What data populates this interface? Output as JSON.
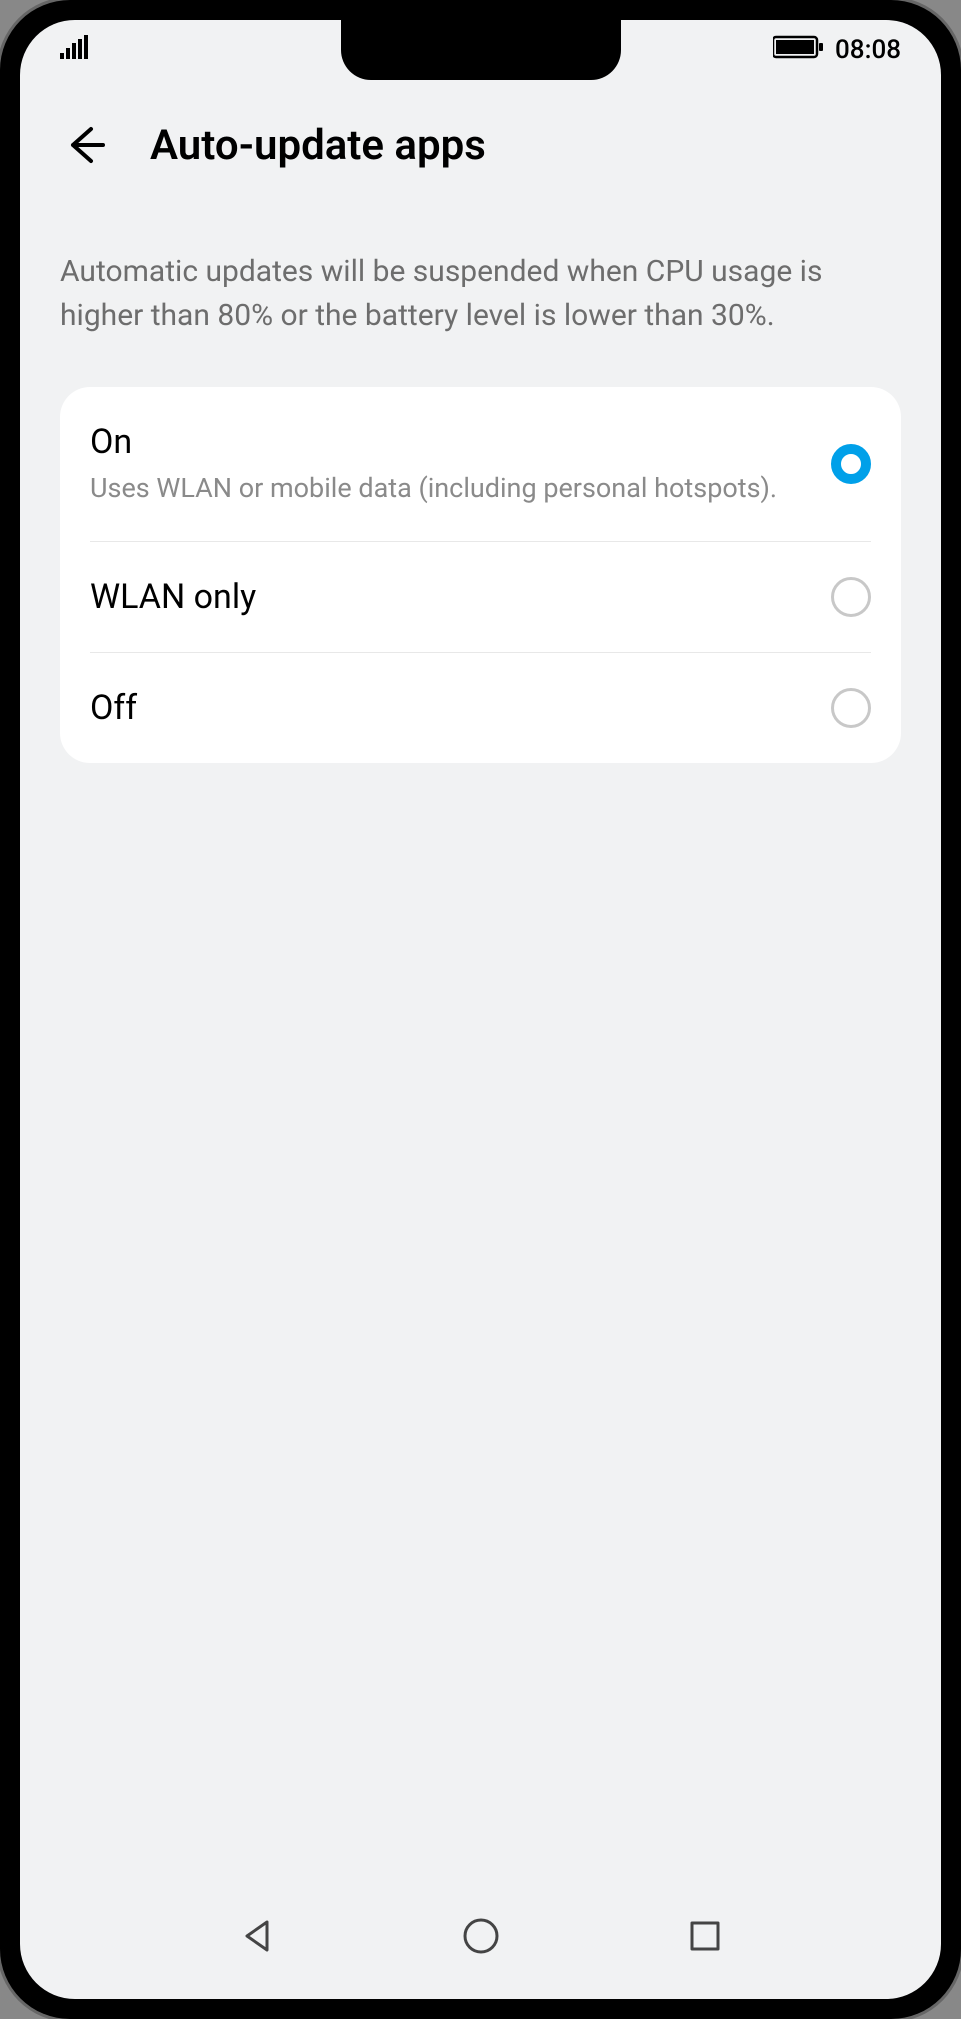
{
  "status_bar": {
    "time": "08:08"
  },
  "header": {
    "title": "Auto-update apps"
  },
  "description": "Automatic updates will be suspended when CPU usage is higher than 80% or the battery level is lower than 30%.",
  "options": [
    {
      "title": "On",
      "subtitle": "Uses WLAN or mobile data (including personal hotspots).",
      "selected": true
    },
    {
      "title": "WLAN only",
      "subtitle": "",
      "selected": false
    },
    {
      "title": "Off",
      "subtitle": "",
      "selected": false
    }
  ]
}
